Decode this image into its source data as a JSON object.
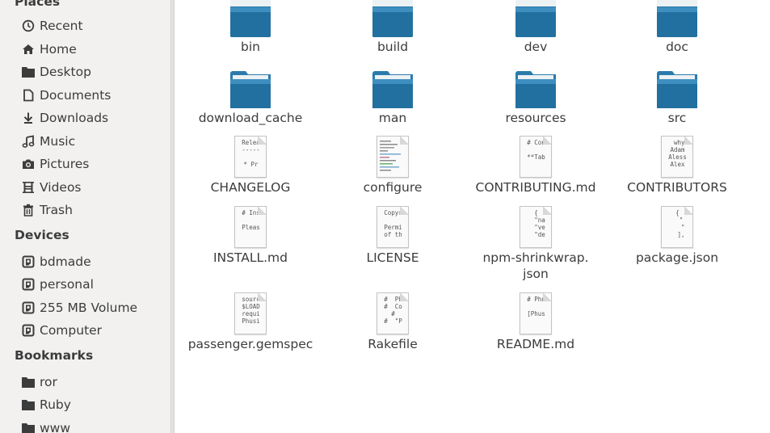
{
  "sidebar": {
    "sections": {
      "places": "Places",
      "devices": "Devices",
      "bookmarks": "Bookmarks"
    },
    "places": [
      {
        "label": "Recent",
        "icon": "clock-icon"
      },
      {
        "label": "Home",
        "icon": "home-icon"
      },
      {
        "label": "Desktop",
        "icon": "folder-icon"
      },
      {
        "label": "Documents",
        "icon": "document-icon"
      },
      {
        "label": "Downloads",
        "icon": "download-icon"
      },
      {
        "label": "Music",
        "icon": "music-icon"
      },
      {
        "label": "Pictures",
        "icon": "camera-icon"
      },
      {
        "label": "Videos",
        "icon": "film-icon"
      },
      {
        "label": "Trash",
        "icon": "trash-icon"
      }
    ],
    "devices": [
      {
        "label": "bdmade",
        "icon": "drive-icon"
      },
      {
        "label": "personal",
        "icon": "drive-icon"
      },
      {
        "label": "255 MB Volume",
        "icon": "drive-icon"
      },
      {
        "label": "Computer",
        "icon": "drive-icon"
      }
    ],
    "bookmarks": [
      {
        "label": "ror",
        "icon": "folder-icon"
      },
      {
        "label": "Ruby",
        "icon": "folder-icon"
      },
      {
        "label": "www",
        "icon": "folder-icon"
      }
    ]
  },
  "files": {
    "folders": [
      "bin",
      "build",
      "dev",
      "doc",
      "download_cache",
      "man",
      "resources",
      "src"
    ],
    "documents": [
      {
        "name": "CHANGELOG",
        "preview": "Relea\n-----\n\n* Pr"
      },
      {
        "name": "configure",
        "preview": ""
      },
      {
        "name": "CONTRIBUTING.md",
        "preview": "# Con\n\n**Tab"
      },
      {
        "name": "CONTRIBUTORS",
        "preview": " why\nAdam\nAless\nAlex"
      },
      {
        "name": "INSTALL.md",
        "preview": "# Ins\n\nPleas"
      },
      {
        "name": "LICENSE",
        "preview": "Copyr\n\nPermi\nof th"
      },
      {
        "name": "npm-shrinkwrap.\njson",
        "preview": "{\n  \"na\n  \"ve\n  \"de"
      },
      {
        "name": "package.json",
        "preview": "{\n  \"\n   \"\n  ],"
      },
      {
        "name": "passenger.gemspec",
        "preview": "sourc\n$LOAD\nrequi\nPhusi"
      },
      {
        "name": "Rakefile",
        "preview": "#  Ph\n#  Co\n#\n#  \"P"
      },
      {
        "name": "README.md",
        "preview": "# Phu\n\n[Phus"
      }
    ]
  },
  "colors": {
    "sidebar_bg": "#f2f1f0",
    "folder_blue": "#1f6d98",
    "text": "#3c3c3c"
  }
}
